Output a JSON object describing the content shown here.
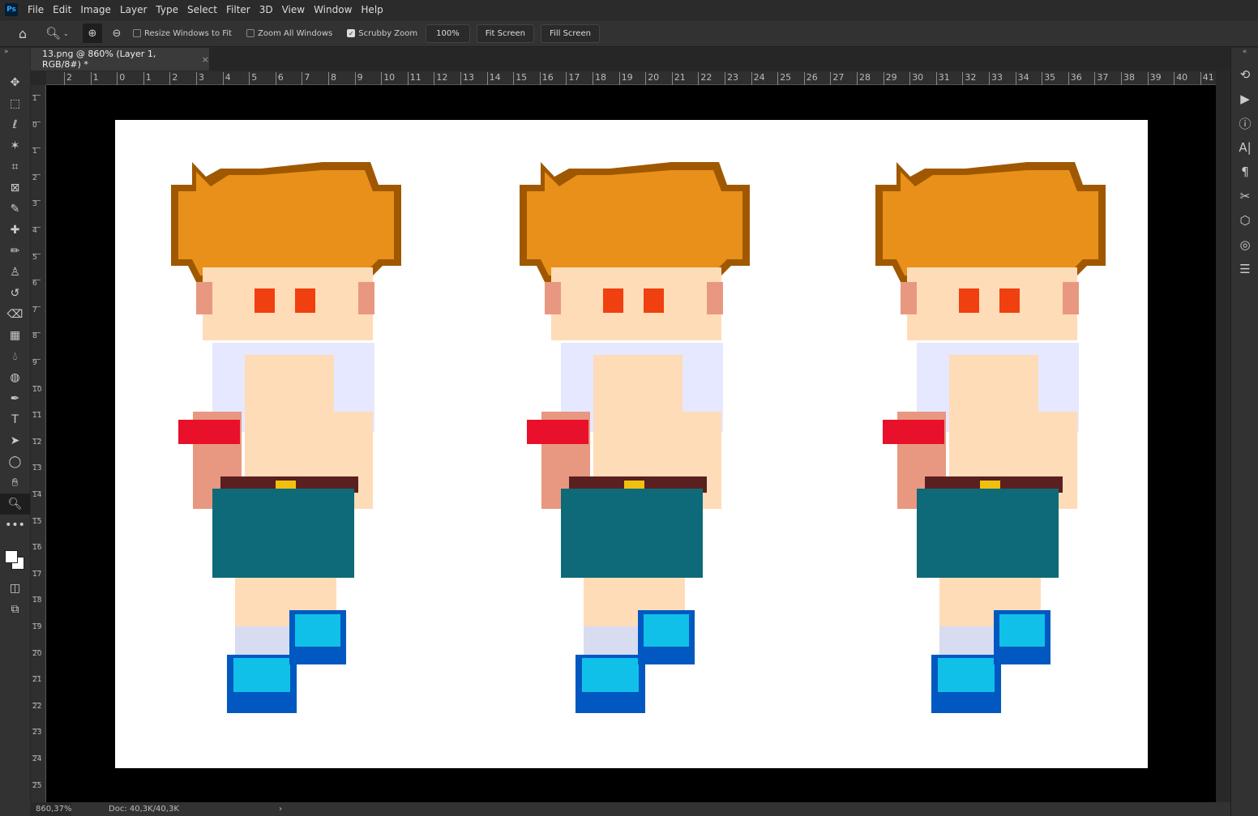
{
  "app": {
    "logo": "Ps"
  },
  "menu": [
    "File",
    "Edit",
    "Image",
    "Layer",
    "Type",
    "Select",
    "Filter",
    "3D",
    "View",
    "Window",
    "Help"
  ],
  "options": {
    "resize_windows": "Resize Windows to Fit",
    "resize_checked": false,
    "zoom_all": "Zoom All Windows",
    "zoom_all_checked": false,
    "scrubby": "Scrubby Zoom",
    "scrubby_checked": true,
    "zoom_value": "100%",
    "fit_screen": "Fit Screen",
    "fill_screen": "Fill Screen"
  },
  "document": {
    "tab_title": "13.png @ 860% (Layer 1, RGB/8#) *"
  },
  "ruler": {
    "top": [
      "2",
      "1",
      "0",
      "1",
      "2",
      "3",
      "4",
      "5",
      "6",
      "7",
      "8",
      "9",
      "10",
      "11",
      "12",
      "13",
      "14",
      "15",
      "16",
      "17",
      "18",
      "19",
      "20",
      "21",
      "22",
      "23",
      "24",
      "25",
      "26",
      "27",
      "28",
      "29",
      "30",
      "31",
      "32",
      "33",
      "34",
      "35",
      "36",
      "37",
      "38",
      "39",
      "40",
      "41"
    ],
    "left": [
      "1",
      "0",
      "1",
      "2",
      "3",
      "4",
      "5",
      "6",
      "7",
      "8",
      "9",
      "10",
      "11",
      "12",
      "13",
      "14",
      "15",
      "16",
      "17",
      "18",
      "19",
      "20",
      "21",
      "22",
      "23",
      "24",
      "25"
    ]
  },
  "status": {
    "zoom": "860,37%",
    "doc": "Doc: 40,3K/40,3K"
  },
  "colors": {
    "hair": "#e8901a",
    "hair_dark": "#a05800",
    "skin": "#ffdcb8",
    "skin_shade": "#e89880",
    "shirt": "#e6e8ff",
    "shorts": "#0e6a78",
    "band": "#e8102a",
    "shoe": "#10c0e8",
    "shoe_dark": "#0058c0"
  }
}
